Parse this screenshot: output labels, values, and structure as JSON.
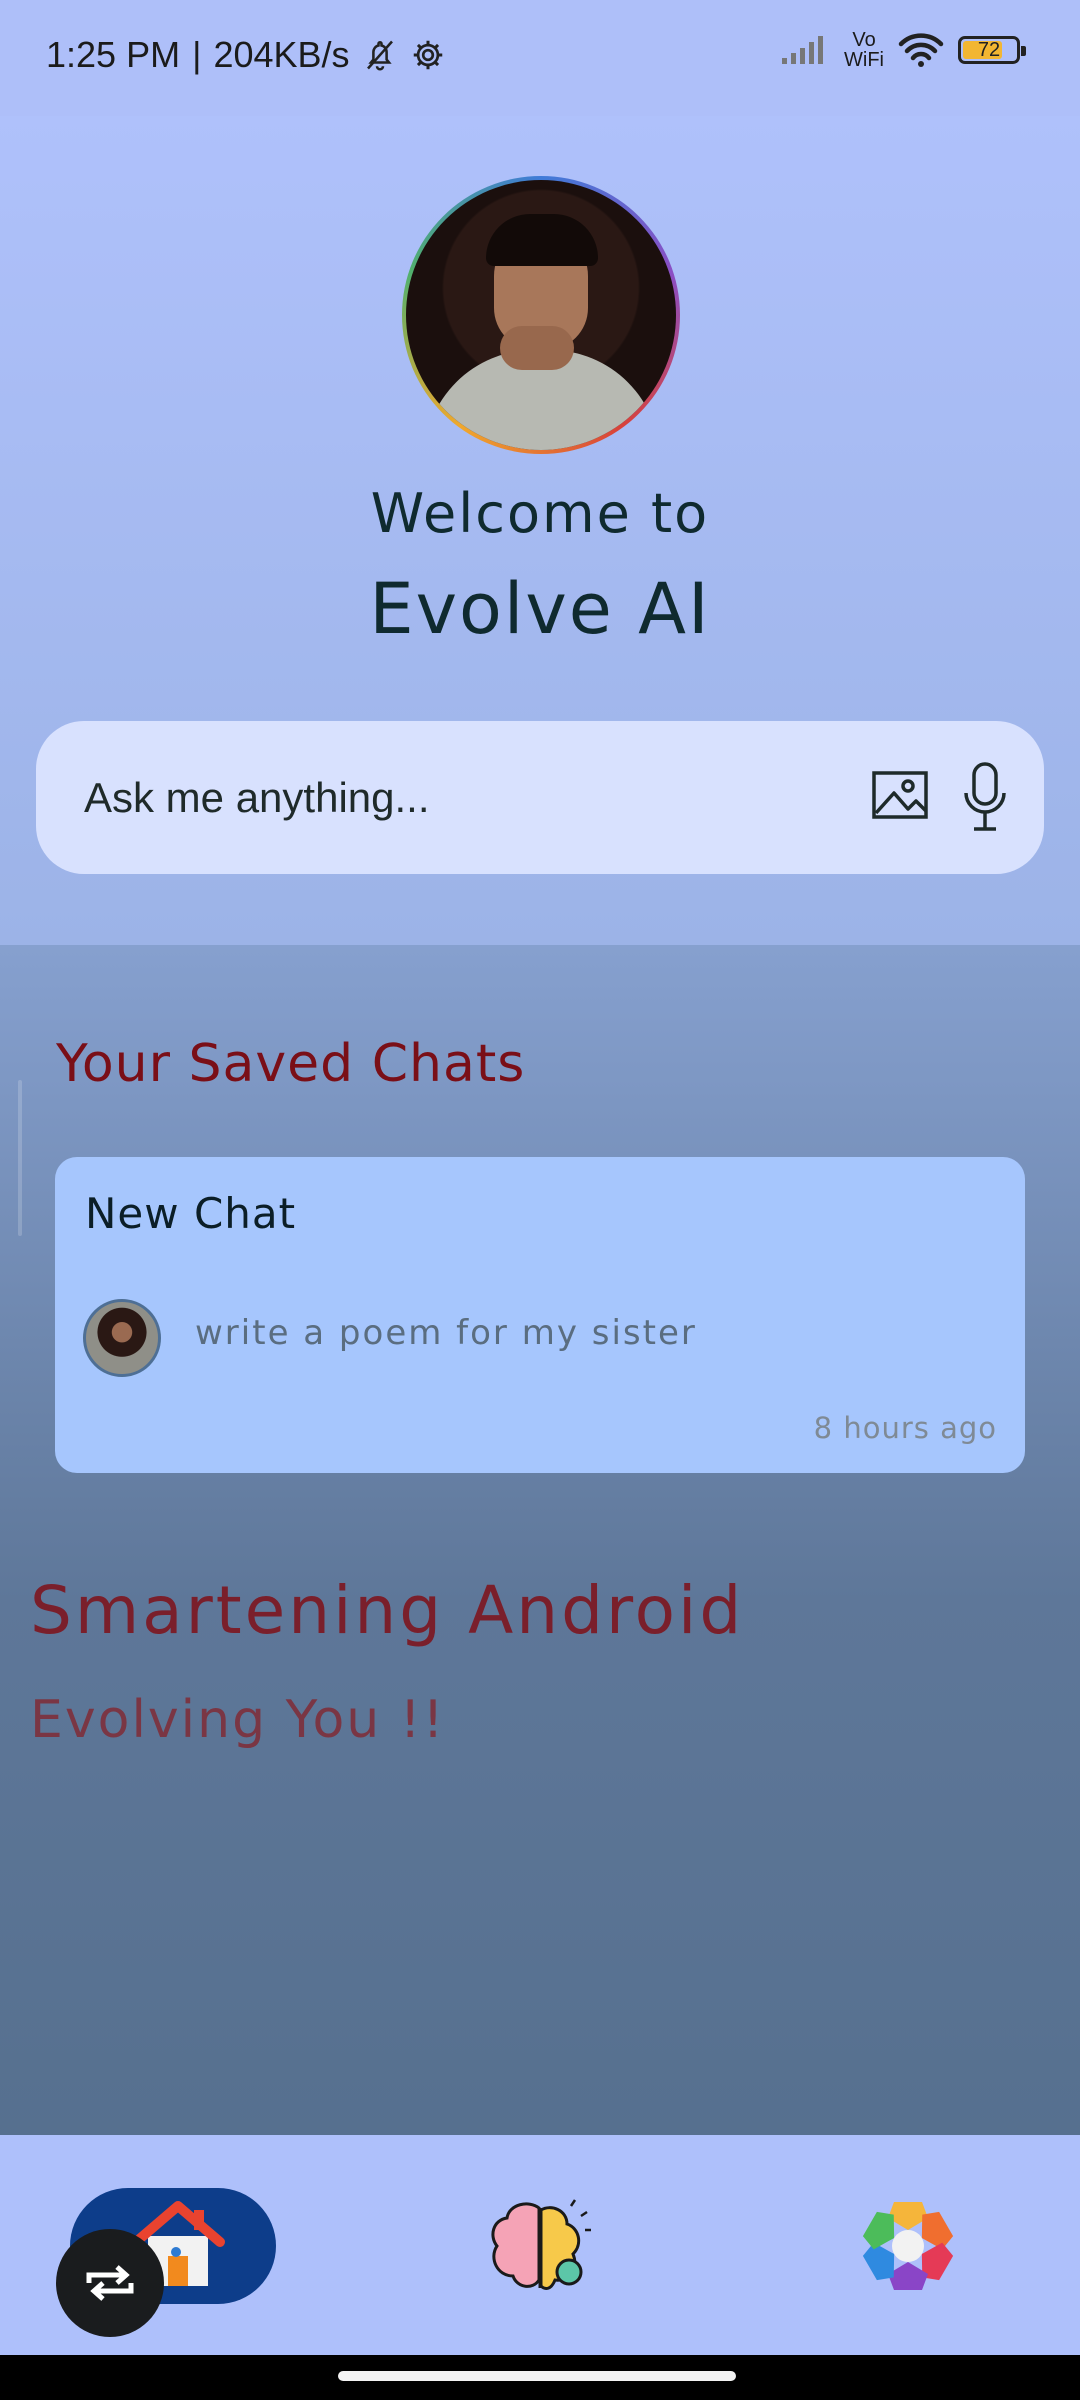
{
  "status": {
    "time": "1:25 PM",
    "network_speed": "204KB/s",
    "battery": "72",
    "vowifi_top": "Vo",
    "vowifi_bottom": "WiFi"
  },
  "hero": {
    "welcome_line1": "Welcome to",
    "welcome_line2": "Evolve AI"
  },
  "search": {
    "placeholder": "Ask me anything..."
  },
  "saved": {
    "title": "Your Saved Chats",
    "chats": [
      {
        "title": "New Chat",
        "preview": "write a poem for my sister",
        "time": "8 hours ago"
      }
    ]
  },
  "tagline": {
    "line1": "Smartening Android",
    "line2": "Evolving You !!"
  },
  "icons": {
    "bell_off": "bell-off-icon",
    "settings_status": "gear-icon",
    "signal": "signal-icon",
    "wifi": "wifi-icon",
    "image": "image-icon",
    "mic": "mic-icon",
    "home": "home-icon",
    "brain": "brain-icon",
    "settings_color": "settings-icon",
    "swap": "swap-icon"
  }
}
